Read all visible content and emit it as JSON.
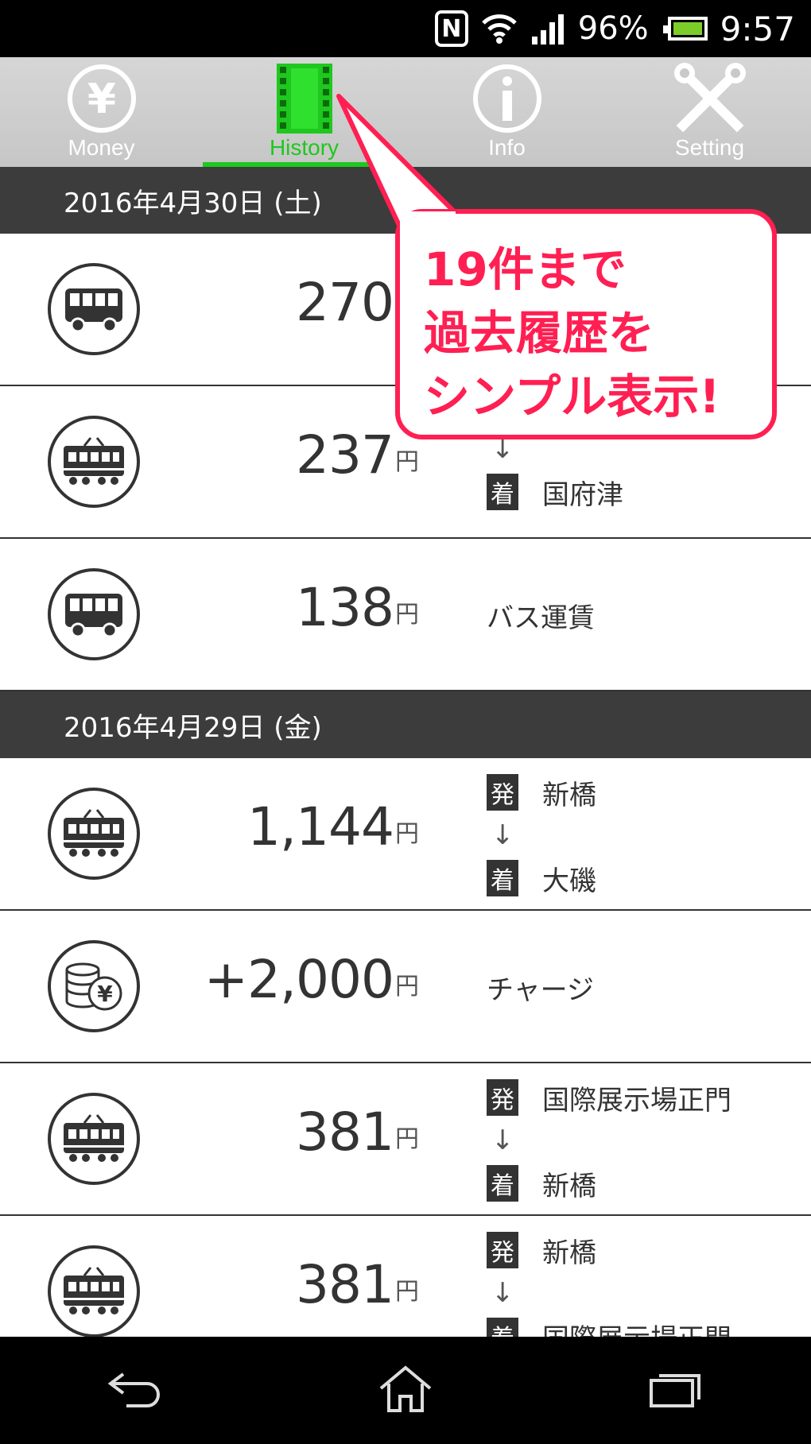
{
  "status_bar": {
    "nfc": "N",
    "battery_percent": "96%",
    "time": "9:57"
  },
  "tabs": [
    {
      "label": "Money",
      "icon": "yen-coin-icon",
      "active": false
    },
    {
      "label": "History",
      "icon": "film-strip-icon",
      "active": true
    },
    {
      "label": "Info",
      "icon": "info-icon",
      "active": false
    },
    {
      "label": "Setting",
      "icon": "tools-icon",
      "active": false
    }
  ],
  "history": {
    "sections": [
      {
        "date": "2016年4月30日 (土)",
        "rows": [
          {
            "icon": "bus-icon",
            "amount": "270",
            "yen": ""
          },
          {
            "icon": "train-icon",
            "amount": "237",
            "yen": "円",
            "arrow": "↓",
            "arrive_badge": "着",
            "arrive": "国府津"
          },
          {
            "icon": "bus-icon",
            "amount": "138",
            "yen": "円",
            "desc": "バス運賃"
          }
        ]
      },
      {
        "date": "2016年4月29日 (金)",
        "rows": [
          {
            "icon": "train-icon",
            "amount": "1,144",
            "yen": "円",
            "depart_badge": "発",
            "depart": "新橋",
            "arrow": "↓",
            "arrive_badge": "着",
            "arrive": "大磯"
          },
          {
            "icon": "coins-yen-icon",
            "amount": "+2,000",
            "yen": "円",
            "desc": "チャージ"
          },
          {
            "icon": "train-icon",
            "amount": "381",
            "yen": "円",
            "depart_badge": "発",
            "depart": "国際展示場正門",
            "arrow": "↓",
            "arrive_badge": "着",
            "arrive": "新橋"
          },
          {
            "icon": "train-icon",
            "amount": "381",
            "yen": "円",
            "depart_badge": "発",
            "depart": "新橋",
            "arrow": "↓",
            "arrive_badge": "着",
            "arrive": "国際展示場正門"
          }
        ]
      }
    ]
  },
  "callout": {
    "line1": "19件まで",
    "line2": "過去履歴を",
    "line3": "シンプル表示!"
  },
  "nav": {
    "back": "back-icon",
    "home": "home-icon",
    "recents": "recents-icon"
  },
  "colors": {
    "accent_green": "#1ec81e",
    "callout_red": "#ff1f52",
    "header_dark": "#3c3c3c"
  }
}
